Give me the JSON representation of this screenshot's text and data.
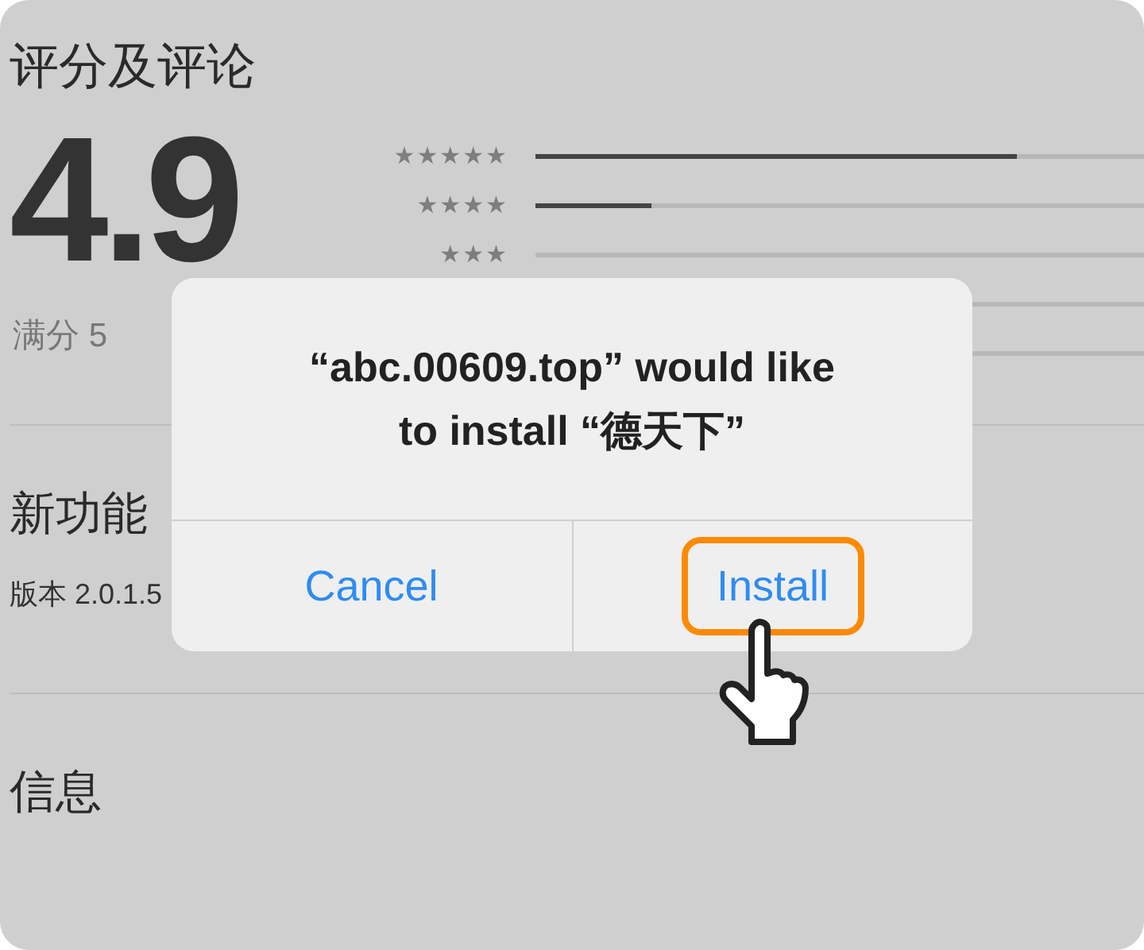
{
  "ratings": {
    "title": "评分及评论",
    "score": "4.9",
    "out_of": "满分 5",
    "bars": [
      {
        "label": "★★★★★",
        "level": 0.79
      },
      {
        "label": "★★★★",
        "level": 0.19
      },
      {
        "label": "★★★"
      }
    ]
  },
  "whats_new": {
    "title": "新功能",
    "version": "版本 2.0.1.5"
  },
  "info": {
    "title": "信息"
  },
  "dialog": {
    "message": "“abc.00609.top” would like to install “德天下”",
    "buttons": [
      {
        "label": "Cancel",
        "highlighted": false
      },
      {
        "label": "Install",
        "highlighted": true
      }
    ]
  }
}
